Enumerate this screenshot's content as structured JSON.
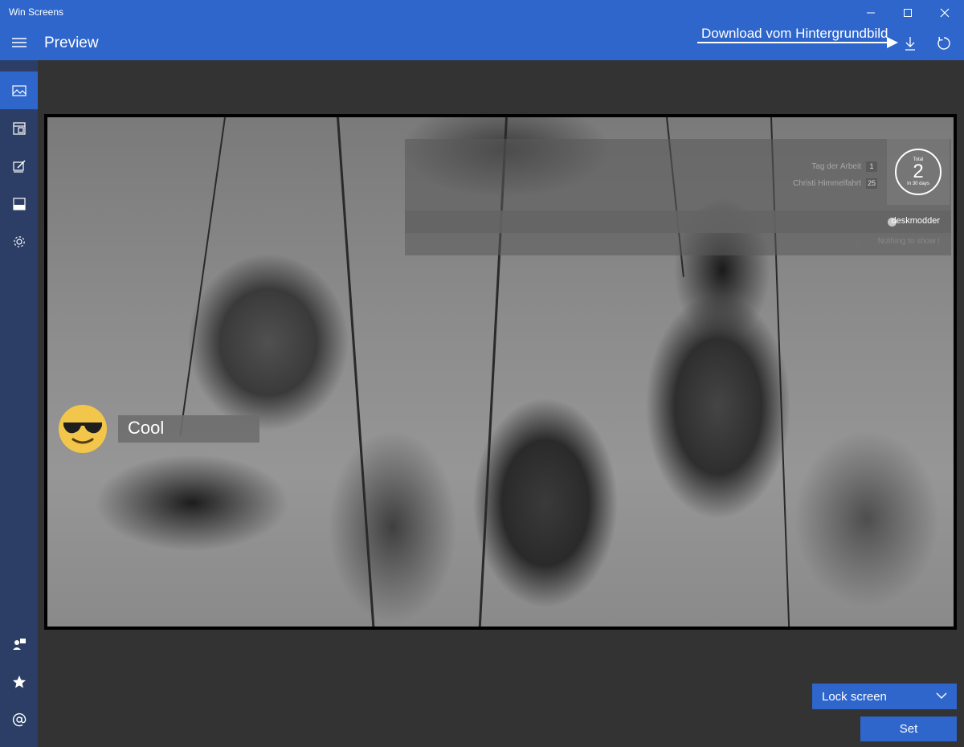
{
  "window": {
    "title": "Win Screens",
    "minimize_icon": "minimize-icon",
    "maximize_icon": "maximize-icon",
    "close_icon": "close-icon"
  },
  "header": {
    "title": "Preview",
    "annotation": "Download vom Hintergrundbild",
    "download_icon": "download-icon",
    "refresh_icon": "refresh-icon",
    "menu_icon": "hamburger-icon"
  },
  "sidebar": {
    "items": [
      {
        "icon": "image-icon",
        "active": true
      },
      {
        "icon": "layout-icon",
        "active": false
      },
      {
        "icon": "edit-icon",
        "active": false
      },
      {
        "icon": "panel-icon",
        "active": false
      },
      {
        "icon": "gear-icon",
        "active": false
      }
    ],
    "bottom_items": [
      {
        "icon": "feedback-icon"
      },
      {
        "icon": "star-icon"
      },
      {
        "icon": "at-icon"
      }
    ]
  },
  "preview": {
    "holidays": [
      {
        "name": "Tag der Arbeit",
        "days": "1"
      },
      {
        "name": "Christi Himmelfahrt",
        "days": "25"
      }
    ],
    "total": {
      "label": "Total",
      "value": "2",
      "sub": "In 30 days"
    },
    "notification": {
      "source": "deskmodder",
      "empty_text": "Nothing to show !"
    },
    "mood": {
      "emoji": "sunglasses-emoji",
      "text": "Cool"
    }
  },
  "controls": {
    "screen_select": "Lock screen",
    "set_label": "Set"
  },
  "colors": {
    "accent": "#2f66cc",
    "sidebar": "#2c3e66",
    "background": "#333333"
  }
}
